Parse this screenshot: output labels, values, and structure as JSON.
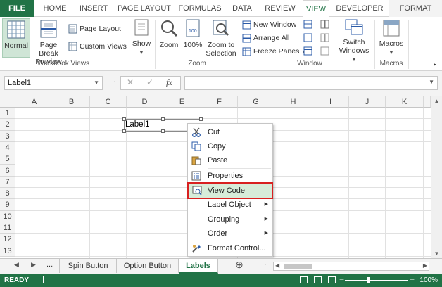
{
  "tabs": [
    "FILE",
    "HOME",
    "INSERT",
    "PAGE LAYOUT",
    "FORMULAS",
    "DATA",
    "REVIEW",
    "VIEW",
    "DEVELOPER",
    "FORMAT"
  ],
  "ribbon": {
    "workbook_views": {
      "normal": "Normal",
      "page_break": [
        "Page Break",
        "Preview"
      ],
      "page_layout": "Page Layout",
      "custom_views": "Custom Views",
      "group": "Workbook Views"
    },
    "show": {
      "label": "Show"
    },
    "zoom": {
      "zoom": "Zoom",
      "hundred": "100%",
      "zoom_sel": [
        "Zoom to",
        "Selection"
      ],
      "group": "Zoom"
    },
    "window": {
      "new_window": "New Window",
      "arrange_all": "Arrange All",
      "freeze_panes": "Freeze Panes",
      "switch": [
        "Switch",
        "Windows"
      ],
      "group": "Window"
    },
    "macros": {
      "label": "Macros",
      "group": "Macros"
    }
  },
  "formula_bar": {
    "name_box": "Label1",
    "fx": "fx",
    "cancel": "✕",
    "enter": "✓",
    "value": ""
  },
  "columns": [
    "A",
    "B",
    "C",
    "D",
    "E",
    "F",
    "G",
    "H",
    "I",
    "J",
    "K"
  ],
  "rows": [
    "1",
    "2",
    "3",
    "4",
    "5",
    "6",
    "7",
    "8",
    "9",
    "10",
    "11",
    "12",
    "13"
  ],
  "label_control": {
    "text": "Label1"
  },
  "context_menu": [
    {
      "label": "Cut",
      "icon": "scissors-icon"
    },
    {
      "label": "Copy",
      "icon": "copy-icon"
    },
    {
      "label": "Paste",
      "icon": "paste-icon"
    },
    {
      "label": "Properties",
      "icon": "properties-icon"
    },
    {
      "label": "View Code",
      "icon": "view-code-icon"
    },
    {
      "label": "Label Object",
      "submenu": true
    },
    {
      "label": "Grouping",
      "submenu": true
    },
    {
      "label": "Order",
      "submenu": true
    },
    {
      "label": "Format Control...",
      "icon": "format-control-icon"
    }
  ],
  "sheets": {
    "ellipsis": "...",
    "tabs": [
      "Spin Button",
      "Option Button",
      "Labels"
    ],
    "active": "Labels",
    "add": "⊕"
  },
  "status": {
    "ready": "READY",
    "zoom": "100%"
  },
  "colors": {
    "accent": "#217346",
    "highlight": "#d82020"
  }
}
